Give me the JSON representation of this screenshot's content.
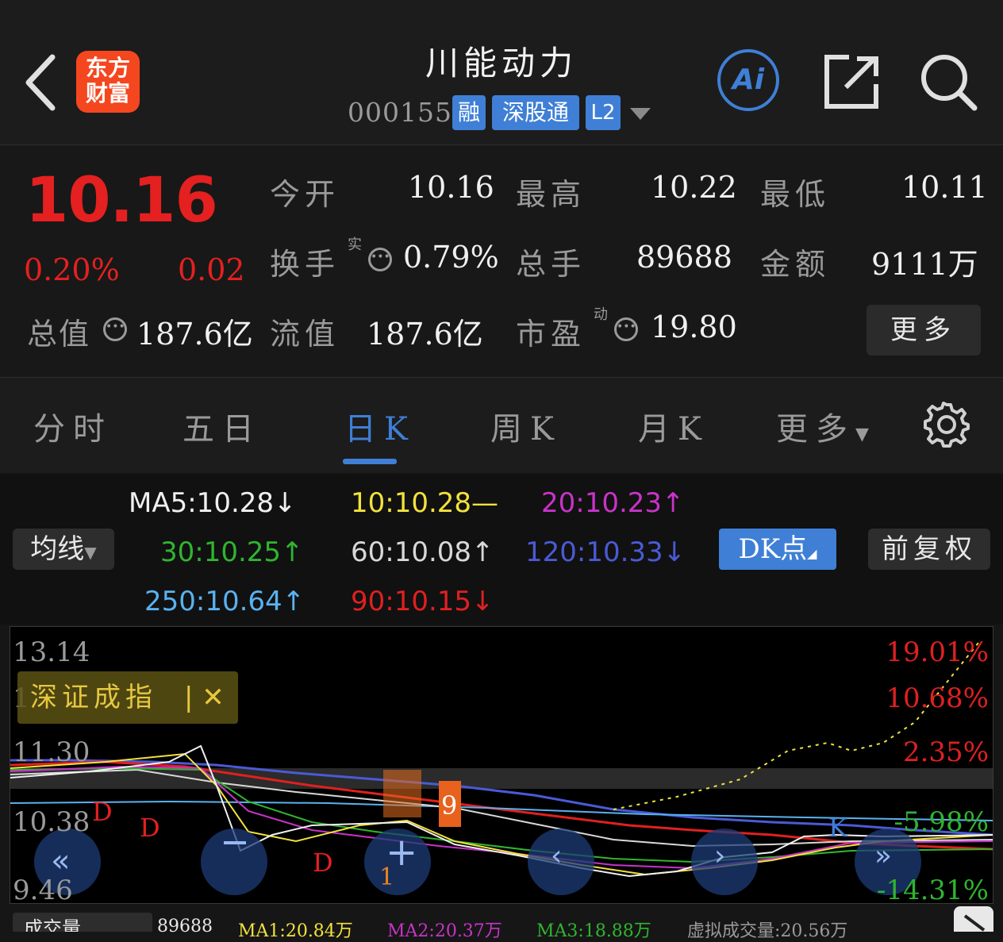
{
  "header": {
    "logo_line1": "东方",
    "logo_line2": "财富",
    "title": "川能动力",
    "code": "000155",
    "tags": [
      "融",
      "深股通",
      "L2"
    ],
    "ai_label": "Ai"
  },
  "quote": {
    "price": "10.16",
    "change_pct": "0.20%",
    "change_abs": "0.02",
    "fields": [
      {
        "label": "今开",
        "value": "10.16",
        "color": "red"
      },
      {
        "label": "最高",
        "value": "10.22",
        "color": "red"
      },
      {
        "label": "最低",
        "value": "10.11",
        "color": "green"
      },
      {
        "label": "换手",
        "sup": "实",
        "value": "0.79%"
      },
      {
        "label": "总手",
        "value": "89688"
      },
      {
        "label": "金额",
        "value": "9111万"
      },
      {
        "label": "总值",
        "value": "187.6亿"
      },
      {
        "label": "流值",
        "value": "187.6亿"
      },
      {
        "label": "市盈",
        "sup": "动",
        "value": "19.80"
      }
    ],
    "more_label": "更多"
  },
  "tabs": [
    "分时",
    "五日",
    "日K",
    "周K",
    "月K",
    "更多"
  ],
  "active_tab": "日K",
  "ma": {
    "selector_label": "均线",
    "items": [
      {
        "text": "MA5:10.28↓",
        "color": "#f0f0f0"
      },
      {
        "text": "10:10.28—",
        "color": "#f2e23c"
      },
      {
        "text": "20:10.23↑",
        "color": "#c833c8"
      },
      {
        "text": "30:10.25↑",
        "color": "#2fb52f"
      },
      {
        "text": "60:10.08↑",
        "color": "#d8d8d8"
      },
      {
        "text": "120:10.33↓",
        "color": "#4a5ad6"
      },
      {
        "text": "250:10.64↑",
        "color": "#59b2f0"
      },
      {
        "text": "90:10.15↓",
        "color": "#e02020"
      }
    ],
    "dk_label": "DK点",
    "adjust_label": "前复权"
  },
  "chart": {
    "y_labels": [
      "13.14",
      "1",
      "11.30",
      "10.38",
      "9.46"
    ],
    "pct_labels": [
      {
        "text": "19.01%",
        "color": "#e02020"
      },
      {
        "text": "10.68%",
        "color": "#e02020"
      },
      {
        "text": "2.35%",
        "color": "#e02020"
      },
      {
        "text": "-5.98%",
        "color": "#2fb52f"
      },
      {
        "text": "-14.31%",
        "color": "#2fb52f"
      }
    ],
    "index_chip": "深证成指",
    "markers": {
      "d": "D",
      "k": "K",
      "nine": "9",
      "one": "1"
    }
  },
  "bottom": {
    "label": "成交量",
    "value": "89688",
    "ma1": "MA1:20.84万",
    "ma2": "MA2:20.37万",
    "ma3": "MA3:18.88万",
    "virtual": "虚拟成交量:20.56万"
  }
}
